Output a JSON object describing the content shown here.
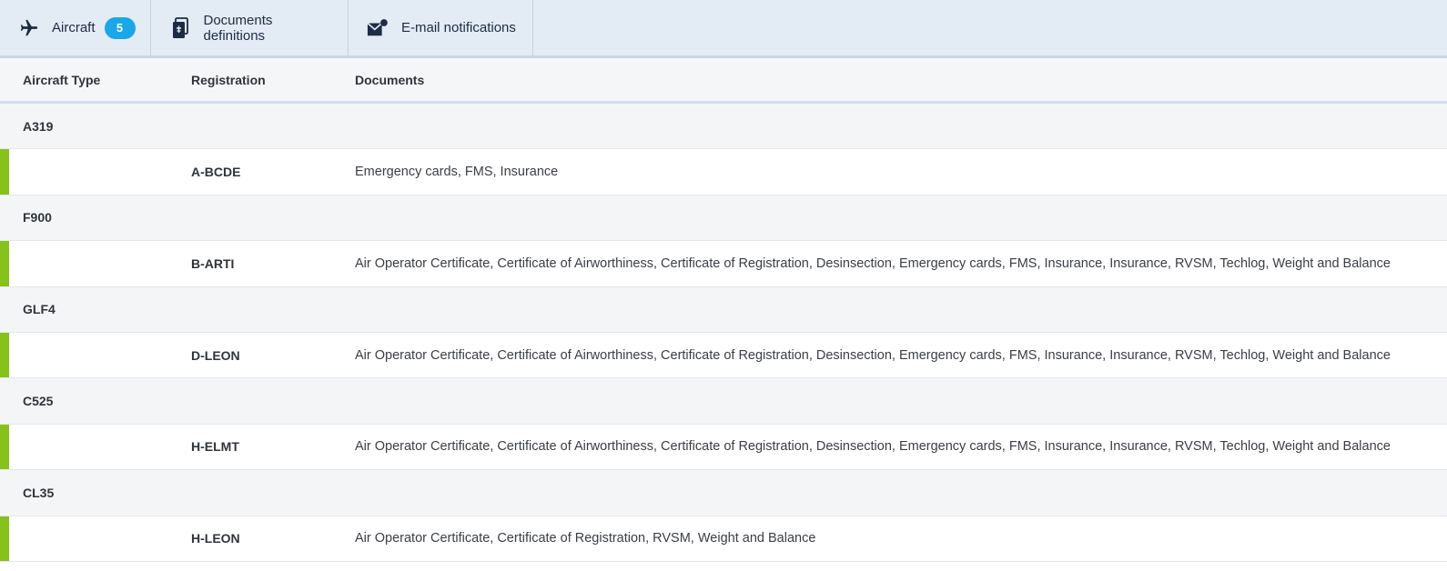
{
  "tabs": [
    {
      "label": "Aircraft",
      "badge": "5",
      "icon": "airplane-icon",
      "active": true
    },
    {
      "label": "Documents definitions",
      "icon": "documents-icon"
    },
    {
      "label": "E-mail notifications",
      "icon": "email-notification-icon"
    }
  ],
  "table": {
    "headers": {
      "aircraft_type": "Aircraft Type",
      "registration": "Registration",
      "documents": "Documents"
    },
    "groups": [
      {
        "type": "A319",
        "registration": "A-BCDE",
        "documents": "Emergency cards, FMS, Insurance"
      },
      {
        "type": "F900",
        "registration": "B-ARTI",
        "documents": "Air Operator Certificate, Certificate of Airworthiness, Certificate of Registration, Desinsection, Emergency cards, FMS, Insurance, Insurance, RVSM, Techlog, Weight and Balance"
      },
      {
        "type": "GLF4",
        "registration": "D-LEON",
        "documents": "Air Operator Certificate, Certificate of Airworthiness, Certificate of Registration, Desinsection, Emergency cards, FMS, Insurance, Insurance, RVSM, Techlog, Weight and Balance"
      },
      {
        "type": "C525",
        "registration": "H-ELMT",
        "documents": "Air Operator Certificate, Certificate of Airworthiness, Certificate of Registration, Desinsection, Emergency cards, FMS, Insurance, Insurance, RVSM, Techlog, Weight and Balance"
      },
      {
        "type": "CL35",
        "registration": "H-LEON",
        "documents": "Air Operator Certificate, Certificate of Registration, RVSM, Weight and Balance"
      }
    ]
  },
  "colors": {
    "tabbar_bg": "#e3ebf4",
    "badge": "#1aa6e8",
    "status_bar": "#86c21a",
    "group_row_bg": "#f4f5f7"
  }
}
